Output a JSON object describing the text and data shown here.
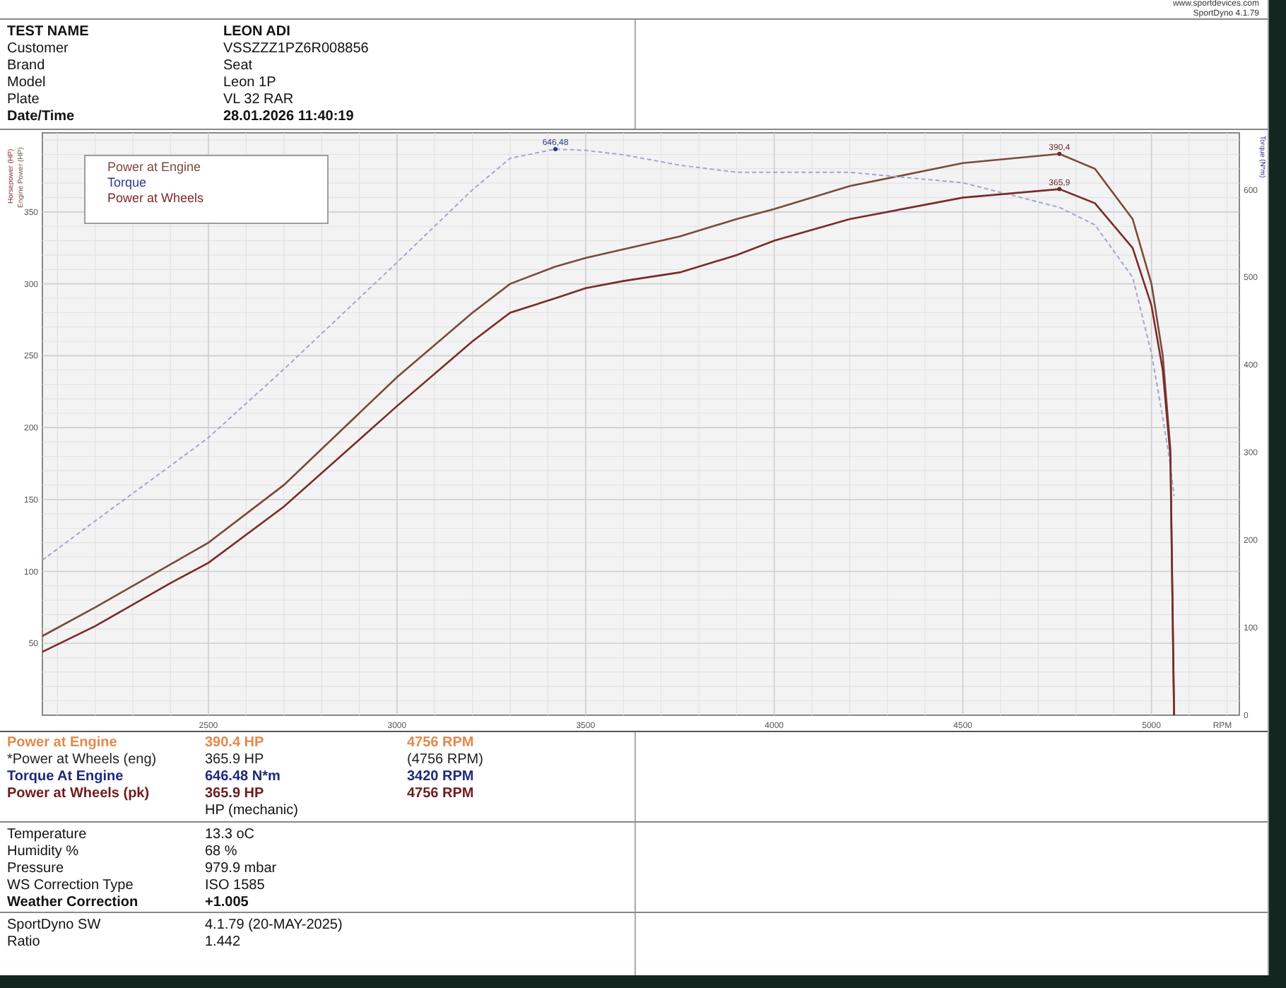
{
  "header": {
    "site": "www.sportdevices.com",
    "software": "SportDyno 4.1.79",
    "fields": [
      {
        "label": "TEST NAME",
        "value": "LEON ADI",
        "bold": true
      },
      {
        "label": "Customer",
        "value": "VSSZZZ1PZ6R008856",
        "bold": false
      },
      {
        "label": "Brand",
        "value": "Seat",
        "bold": false
      },
      {
        "label": "Model",
        "value": "Leon 1P",
        "bold": false
      },
      {
        "label": "Plate",
        "value": "VL 32 RAR",
        "bold": false
      },
      {
        "label": "Date/Time",
        "value": "28.01.2026 11:40:19",
        "bold": true
      }
    ]
  },
  "chart": {
    "second_ylabel": "Engine Power (HP)",
    "chart_data": {
      "type": "line",
      "xlabel": "RPM",
      "ylabel": "Horsepower (HP)",
      "y2label": "Torque (N*m)",
      "x": [
        2060,
        2200,
        2400,
        2500,
        2700,
        3000,
        3200,
        3300,
        3420,
        3500,
        3600,
        3750,
        3900,
        4000,
        4200,
        4500,
        4756,
        4850,
        4950,
        5000,
        5030,
        5050,
        5060
      ],
      "series": [
        {
          "name": "Power at Engine",
          "color": "#7a4a3a",
          "line_style": "solid",
          "values": [
            55,
            75,
            105,
            120,
            160,
            235,
            280,
            300,
            312,
            318,
            324,
            333,
            345,
            352,
            368,
            384,
            390.4,
            380,
            345,
            300,
            250,
            185,
            0
          ]
        },
        {
          "name": "Torque",
          "color": "#a0a6cc",
          "axis": "y2",
          "line_style": "dashed",
          "values": [
            177,
            222,
            285,
            317,
            395,
            517,
            600,
            636,
            646.48,
            645,
            640,
            628,
            620,
            620,
            620,
            608,
            580,
            560,
            500,
            413,
            340,
            285,
            250
          ]
        },
        {
          "name": "Power at Wheels",
          "color": "#7a2a2a",
          "line_style": "solid",
          "values": [
            44,
            62,
            92,
            106,
            145,
            215,
            260,
            280,
            290,
            297,
            302,
            308,
            320,
            330,
            345,
            360,
            365.9,
            356,
            325,
            285,
            240,
            180,
            0
          ]
        }
      ],
      "xlim": [
        2060,
        5233
      ],
      "ylim": [
        0,
        405
      ],
      "y2lim": [
        0,
        665
      ],
      "xticks": [
        2500,
        3000,
        3500,
        4000,
        4500,
        5000
      ],
      "yticks": [
        50,
        100,
        150,
        200,
        250,
        300,
        350
      ],
      "y2ticks": [
        0,
        100,
        200,
        300,
        400,
        500,
        600
      ],
      "annotations": [
        "390,4",
        "646,48",
        "365,9"
      ],
      "grid": true
    }
  },
  "results": [
    {
      "label": "Power at Engine",
      "value": "390.4 HP",
      "rpm": "4756 RPM",
      "color": "#e08a4e",
      "bold": true
    },
    {
      "label": "*Power at Wheels (eng)",
      "value": "365.9 HP",
      "rpm": "(4756 RPM)",
      "color": "#222222",
      "bold": false
    },
    {
      "label": "Torque At Engine",
      "value": "646.48 N*m",
      "rpm": "3420 RPM",
      "color": "#1f2a78",
      "bold": true
    },
    {
      "label": "Power at Wheels (pk)",
      "value": "365.9 HP",
      "rpm": "4756 RPM",
      "color": "#6e1c1c",
      "bold": true
    }
  ],
  "results_note": "HP (mechanic)",
  "conditions": [
    {
      "label": "Temperature",
      "value": "13.3 oC",
      "bold": false
    },
    {
      "label": "Humidity %",
      "value": "68 %",
      "bold": false
    },
    {
      "label": "Pressure",
      "value": "979.9 mbar",
      "bold": false
    },
    {
      "label": "WS Correction Type",
      "value": "ISO 1585",
      "bold": false
    },
    {
      "label": "Weather Correction",
      "value": "+1.005",
      "bold": true
    }
  ],
  "software_info": [
    {
      "label": "SportDyno SW",
      "value": "4.1.79 (20-MAY-2025)"
    },
    {
      "label": "Ratio",
      "value": "1.442"
    }
  ]
}
